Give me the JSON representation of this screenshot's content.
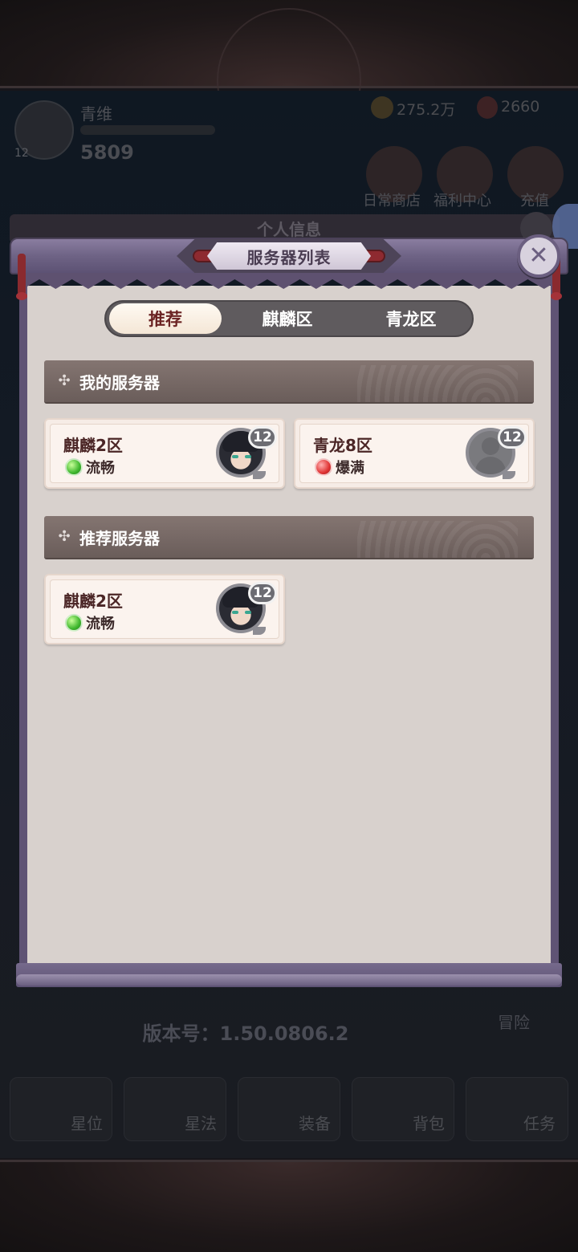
{
  "background": {
    "player_name": "青维",
    "player_level": "12",
    "power": "5809",
    "coins": "275.2万",
    "gems": "2660",
    "shortcuts": [
      "日常商店",
      "福利中心",
      "充值"
    ],
    "version": "版本号：1.50.0806.2",
    "side_label": "冒险",
    "dock": [
      "星位",
      "星法",
      "装备",
      "背包",
      "任务"
    ],
    "underlying_dialog_title": "个人信息"
  },
  "dialog": {
    "title": "服务器列表",
    "close_icon": "close-icon",
    "tabs": [
      {
        "label": "推荐",
        "active": true
      },
      {
        "label": "麒麟区",
        "active": false
      },
      {
        "label": "青龙区",
        "active": false
      }
    ],
    "my_servers": {
      "title": "我的服务器",
      "items": [
        {
          "name": "麒麟2区",
          "status": "流畅",
          "status_color": "green",
          "level": "12",
          "avatar": "hero"
        },
        {
          "name": "青龙8区",
          "status": "爆满",
          "status_color": "red",
          "level": "12",
          "avatar": "empty"
        }
      ]
    },
    "recommended_servers": {
      "title": "推荐服务器",
      "items": [
        {
          "name": "麒麟2区",
          "status": "流畅",
          "status_color": "green",
          "level": "12",
          "avatar": "hero"
        }
      ]
    }
  },
  "colors": {
    "frame": "#6e6385",
    "paper": "#d8d1cd",
    "card": "#f6ece6",
    "status_green": "#3fb72e",
    "status_red": "#e03434",
    "active_tab_text": "#6b2323"
  }
}
